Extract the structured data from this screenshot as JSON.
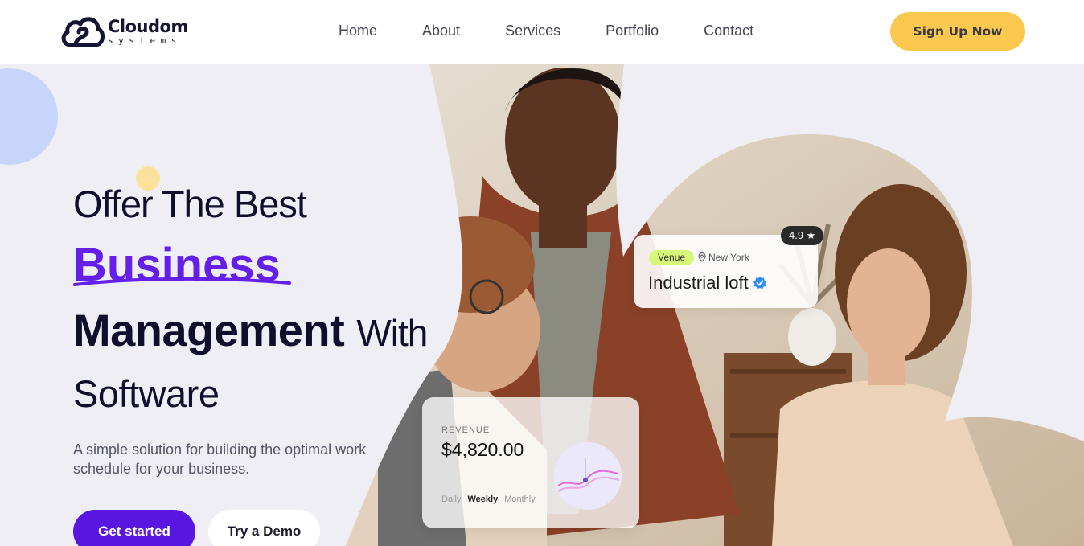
{
  "brand": {
    "name": "Cloudom",
    "tagline": "systems"
  },
  "nav": {
    "items": [
      {
        "label": "Home"
      },
      {
        "label": "About"
      },
      {
        "label": "Services"
      },
      {
        "label": "Portfolio"
      },
      {
        "label": "Contact"
      }
    ],
    "cta": "Sign Up Now"
  },
  "hero": {
    "line1": "Offer The Best",
    "line2": "Business",
    "line3_bold": "Management",
    "line3_light": "With",
    "line4": "Software",
    "subtitle": "A simple solution for building the optimal work schedule for your business.",
    "primary_button": "Get started",
    "secondary_button": "Try a Demo"
  },
  "venue_card": {
    "tag": "Venue",
    "location": "New York",
    "title": "Industrial loft",
    "rating": "4.9 ★"
  },
  "revenue_card": {
    "label": "REVENUE",
    "value": "$4,820.00",
    "tabs": [
      {
        "label": "Daily"
      },
      {
        "label": "Weekly"
      },
      {
        "label": "Monthly"
      }
    ],
    "active_tab": "Weekly"
  },
  "colors": {
    "accent": "#5a16e1",
    "headline_accent": "#6420ea",
    "cta": "#fbc84f",
    "tag": "#d6f77a",
    "background": "#eeeef4"
  }
}
